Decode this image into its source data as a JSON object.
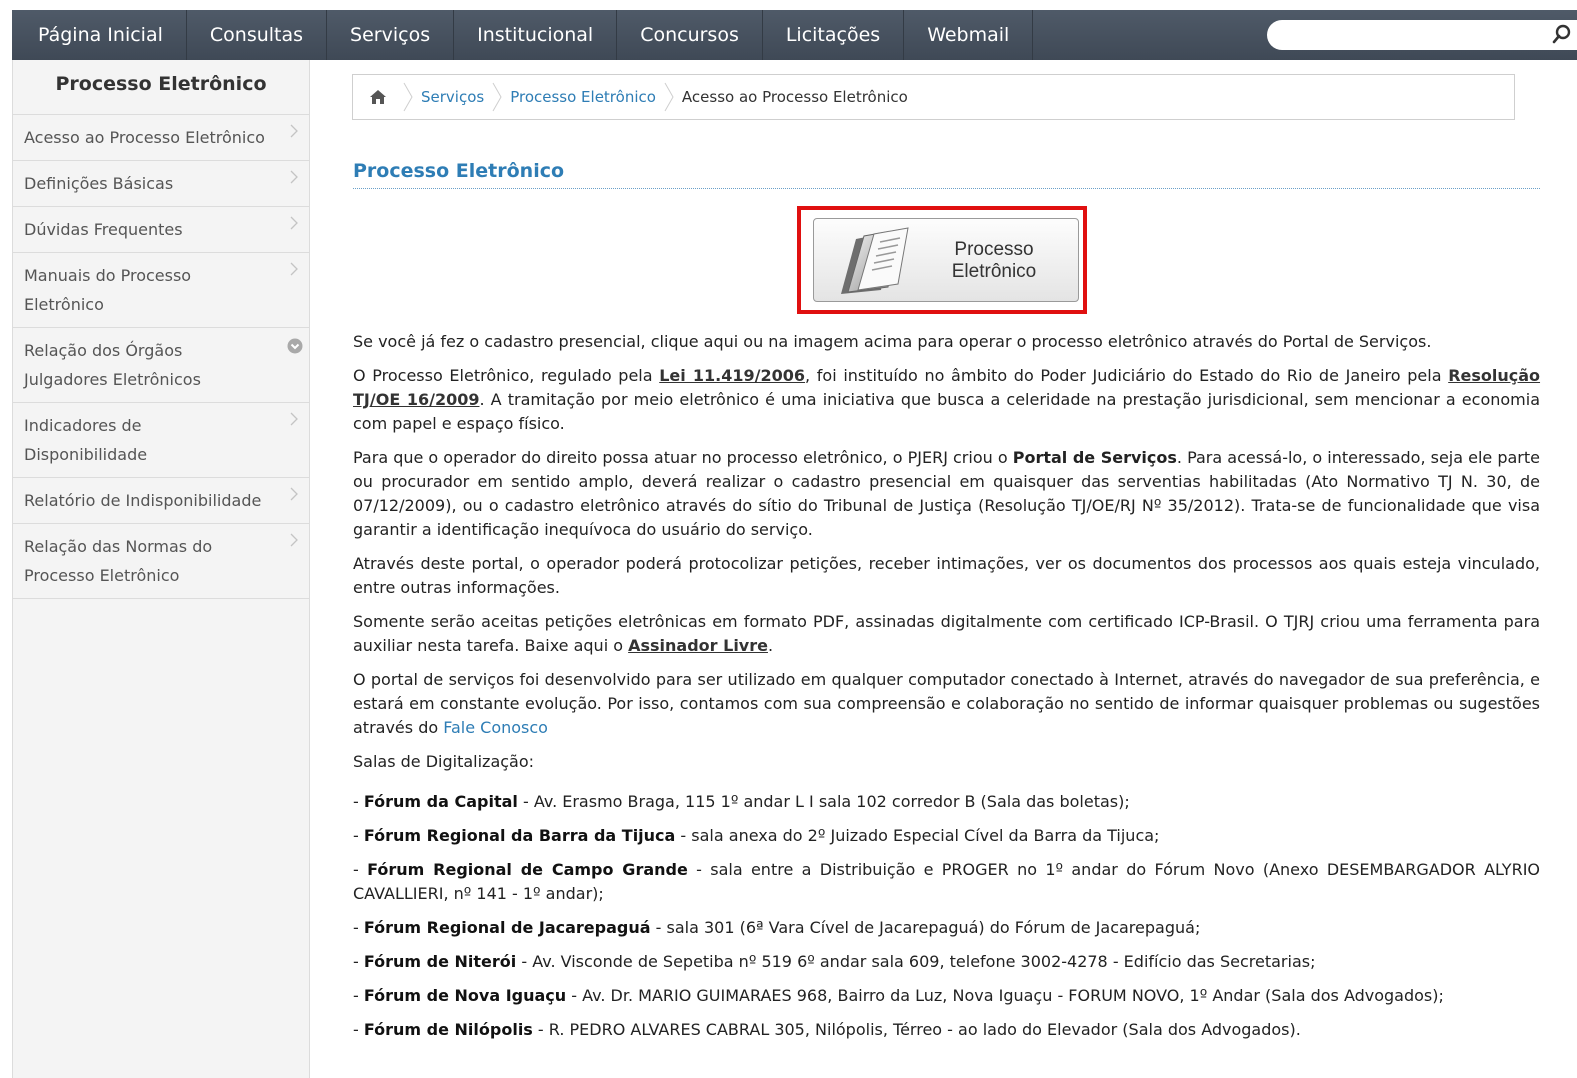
{
  "nav": {
    "items": [
      "Página Inicial",
      "Consultas",
      "Serviços",
      "Institucional",
      "Concursos",
      "Licitações",
      "Webmail"
    ],
    "search_placeholder": ""
  },
  "sidebar": {
    "title": "Processo Eletrônico",
    "items": [
      {
        "label": "Acesso ao Processo Eletrônico",
        "icon": "chevron-right-icon"
      },
      {
        "label": "Definições Básicas",
        "icon": "chevron-right-icon"
      },
      {
        "label": "Dúvidas Frequentes",
        "icon": "chevron-right-icon"
      },
      {
        "label": "Manuais do Processo Eletrônico",
        "icon": "chevron-right-icon"
      },
      {
        "label": "Relação dos Órgãos Julgadores Eletrônicos",
        "icon": "chevron-down-circle-icon"
      },
      {
        "label": "Indicadores de Disponibilidade",
        "icon": "chevron-right-icon"
      },
      {
        "label": "Relatório de Indisponibilidade",
        "icon": "chevron-right-icon"
      },
      {
        "label": "Relação das Normas do Processo Eletrônico",
        "icon": "chevron-right-icon"
      }
    ]
  },
  "breadcrumb": {
    "items": [
      "Serviços",
      "Processo Eletrônico",
      "Acesso ao Processo Eletrônico"
    ]
  },
  "main": {
    "title": "Processo Eletrônico",
    "banner_line1": "Processo",
    "banner_line2": "Eletrônico",
    "p1": "Se você já fez o cadastro presencial, clique aqui ou na imagem acima para operar o processo eletrônico através do Portal de Serviços.",
    "p2_a": "O Processo Eletrônico, regulado pela ",
    "p2_link1": "Lei 11.419/2006",
    "p2_b": ", foi instituído no âmbito do Poder Judiciário do Estado do Rio de Janeiro pela ",
    "p2_link2": "Resolução TJ/OE 16/2009",
    "p2_c": ". A tramitação por meio eletrônico é uma iniciativa que busca a celeridade na prestação jurisdicional, sem mencionar a economia com papel e espaço físico.",
    "p3_a": "Para que o operador do direito possa atuar no processo eletrônico, o PJERJ criou o ",
    "p3_bold": "Portal de Serviços",
    "p3_b": ". Para acessá-lo, o interessado, seja ele parte ou procurador em sentido amplo, deverá realizar o cadastro presencial em quaisquer das serventias habilitadas (Ato Normativo TJ N. 30, de 07/12/2009), ou o cadastro eletrônico através do sítio do Tribunal de Justiça (Resolução TJ/OE/RJ Nº 35/2012). Trata-se de funcionalidade que visa garantir a identificação inequívoca do usuário do serviço.",
    "p4": "Através deste portal, o operador poderá protocolizar petições, receber intimações, ver os documentos dos processos aos quais esteja vinculado, entre outras informações.",
    "p5_a": "Somente serão aceitas petições eletrônicas em formato PDF, assinadas digitalmente com certificado ICP-Brasil. O TJRJ criou uma ferramenta para auxiliar nesta tarefa. Baixe aqui o ",
    "p5_link": "Assinador Livre",
    "p5_b": ".",
    "p6_a": "O portal de serviços foi desenvolvido para ser utilizado em qualquer computador conectado à Internet, através do navegador de sua preferência, e estará em constante evolução. Por isso, contamos com sua compreensão e colaboração no sentido de informar quaisquer problemas ou sugestões através do ",
    "p6_link": "Fale Conosco",
    "salas_title": "Salas de Digitalização:",
    "salas": [
      {
        "name": "Fórum da Capital",
        "desc": " - Av. Erasmo Braga, 115 1º andar L I sala 102 corredor B (Sala das boletas);"
      },
      {
        "name": "Fórum Regional da Barra da Tijuca",
        "desc": " - sala anexa do 2º Juizado Especial Cível da Barra da Tijuca;"
      },
      {
        "name": "Fórum Regional de Campo Grande",
        "desc": " - sala entre a Distribuição e PROGER no 1º andar do Fórum Novo (Anexo DESEMBARGADOR ALYRIO CAVALLIERI, nº 141 - 1º andar);"
      },
      {
        "name": "Fórum Regional de Jacarepaguá",
        "desc": " - sala 301 (6ª Vara Cível de Jacarepaguá) do Fórum de Jacarepaguá;"
      },
      {
        "name": "Fórum de Niterói",
        "desc": " - Av. Visconde de Sepetiba nº 519 6º andar sala 609, telefone 3002-4278 - Edifício das Secretarias;"
      },
      {
        "name": "Fórum de Nova Iguaçu",
        "desc": " - Av. Dr. MARIO GUIMARAES 968, Bairro da Luz, Nova Iguaçu - FORUM NOVO, 1º Andar (Sala dos Advogados);"
      },
      {
        "name": "Fórum de Nilópolis",
        "desc": " - R. PEDRO ALVARES CABRAL 305, Nilópolis, Térreo - ao lado do Elevador (Sala dos Advogados)."
      }
    ]
  }
}
